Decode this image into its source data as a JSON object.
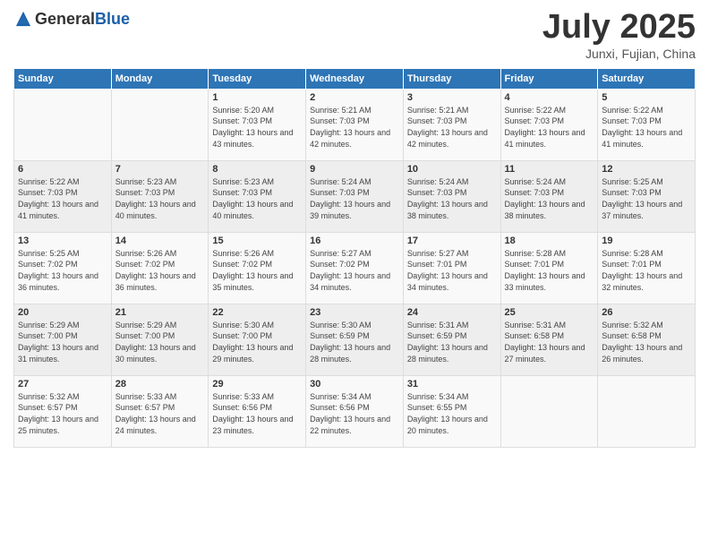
{
  "header": {
    "logo_general": "General",
    "logo_blue": "Blue",
    "month_year": "July 2025",
    "location": "Junxi, Fujian, China"
  },
  "weekdays": [
    "Sunday",
    "Monday",
    "Tuesday",
    "Wednesday",
    "Thursday",
    "Friday",
    "Saturday"
  ],
  "weeks": [
    [
      {
        "day": null,
        "sunrise": null,
        "sunset": null,
        "daylight": null
      },
      {
        "day": null,
        "sunrise": null,
        "sunset": null,
        "daylight": null
      },
      {
        "day": "1",
        "sunrise": "Sunrise: 5:20 AM",
        "sunset": "Sunset: 7:03 PM",
        "daylight": "Daylight: 13 hours and 43 minutes."
      },
      {
        "day": "2",
        "sunrise": "Sunrise: 5:21 AM",
        "sunset": "Sunset: 7:03 PM",
        "daylight": "Daylight: 13 hours and 42 minutes."
      },
      {
        "day": "3",
        "sunrise": "Sunrise: 5:21 AM",
        "sunset": "Sunset: 7:03 PM",
        "daylight": "Daylight: 13 hours and 42 minutes."
      },
      {
        "day": "4",
        "sunrise": "Sunrise: 5:22 AM",
        "sunset": "Sunset: 7:03 PM",
        "daylight": "Daylight: 13 hours and 41 minutes."
      },
      {
        "day": "5",
        "sunrise": "Sunrise: 5:22 AM",
        "sunset": "Sunset: 7:03 PM",
        "daylight": "Daylight: 13 hours and 41 minutes."
      }
    ],
    [
      {
        "day": "6",
        "sunrise": "Sunrise: 5:22 AM",
        "sunset": "Sunset: 7:03 PM",
        "daylight": "Daylight: 13 hours and 41 minutes."
      },
      {
        "day": "7",
        "sunrise": "Sunrise: 5:23 AM",
        "sunset": "Sunset: 7:03 PM",
        "daylight": "Daylight: 13 hours and 40 minutes."
      },
      {
        "day": "8",
        "sunrise": "Sunrise: 5:23 AM",
        "sunset": "Sunset: 7:03 PM",
        "daylight": "Daylight: 13 hours and 40 minutes."
      },
      {
        "day": "9",
        "sunrise": "Sunrise: 5:24 AM",
        "sunset": "Sunset: 7:03 PM",
        "daylight": "Daylight: 13 hours and 39 minutes."
      },
      {
        "day": "10",
        "sunrise": "Sunrise: 5:24 AM",
        "sunset": "Sunset: 7:03 PM",
        "daylight": "Daylight: 13 hours and 38 minutes."
      },
      {
        "day": "11",
        "sunrise": "Sunrise: 5:24 AM",
        "sunset": "Sunset: 7:03 PM",
        "daylight": "Daylight: 13 hours and 38 minutes."
      },
      {
        "day": "12",
        "sunrise": "Sunrise: 5:25 AM",
        "sunset": "Sunset: 7:03 PM",
        "daylight": "Daylight: 13 hours and 37 minutes."
      }
    ],
    [
      {
        "day": "13",
        "sunrise": "Sunrise: 5:25 AM",
        "sunset": "Sunset: 7:02 PM",
        "daylight": "Daylight: 13 hours and 36 minutes."
      },
      {
        "day": "14",
        "sunrise": "Sunrise: 5:26 AM",
        "sunset": "Sunset: 7:02 PM",
        "daylight": "Daylight: 13 hours and 36 minutes."
      },
      {
        "day": "15",
        "sunrise": "Sunrise: 5:26 AM",
        "sunset": "Sunset: 7:02 PM",
        "daylight": "Daylight: 13 hours and 35 minutes."
      },
      {
        "day": "16",
        "sunrise": "Sunrise: 5:27 AM",
        "sunset": "Sunset: 7:02 PM",
        "daylight": "Daylight: 13 hours and 34 minutes."
      },
      {
        "day": "17",
        "sunrise": "Sunrise: 5:27 AM",
        "sunset": "Sunset: 7:01 PM",
        "daylight": "Daylight: 13 hours and 34 minutes."
      },
      {
        "day": "18",
        "sunrise": "Sunrise: 5:28 AM",
        "sunset": "Sunset: 7:01 PM",
        "daylight": "Daylight: 13 hours and 33 minutes."
      },
      {
        "day": "19",
        "sunrise": "Sunrise: 5:28 AM",
        "sunset": "Sunset: 7:01 PM",
        "daylight": "Daylight: 13 hours and 32 minutes."
      }
    ],
    [
      {
        "day": "20",
        "sunrise": "Sunrise: 5:29 AM",
        "sunset": "Sunset: 7:00 PM",
        "daylight": "Daylight: 13 hours and 31 minutes."
      },
      {
        "day": "21",
        "sunrise": "Sunrise: 5:29 AM",
        "sunset": "Sunset: 7:00 PM",
        "daylight": "Daylight: 13 hours and 30 minutes."
      },
      {
        "day": "22",
        "sunrise": "Sunrise: 5:30 AM",
        "sunset": "Sunset: 7:00 PM",
        "daylight": "Daylight: 13 hours and 29 minutes."
      },
      {
        "day": "23",
        "sunrise": "Sunrise: 5:30 AM",
        "sunset": "Sunset: 6:59 PM",
        "daylight": "Daylight: 13 hours and 28 minutes."
      },
      {
        "day": "24",
        "sunrise": "Sunrise: 5:31 AM",
        "sunset": "Sunset: 6:59 PM",
        "daylight": "Daylight: 13 hours and 28 minutes."
      },
      {
        "day": "25",
        "sunrise": "Sunrise: 5:31 AM",
        "sunset": "Sunset: 6:58 PM",
        "daylight": "Daylight: 13 hours and 27 minutes."
      },
      {
        "day": "26",
        "sunrise": "Sunrise: 5:32 AM",
        "sunset": "Sunset: 6:58 PM",
        "daylight": "Daylight: 13 hours and 26 minutes."
      }
    ],
    [
      {
        "day": "27",
        "sunrise": "Sunrise: 5:32 AM",
        "sunset": "Sunset: 6:57 PM",
        "daylight": "Daylight: 13 hours and 25 minutes."
      },
      {
        "day": "28",
        "sunrise": "Sunrise: 5:33 AM",
        "sunset": "Sunset: 6:57 PM",
        "daylight": "Daylight: 13 hours and 24 minutes."
      },
      {
        "day": "29",
        "sunrise": "Sunrise: 5:33 AM",
        "sunset": "Sunset: 6:56 PM",
        "daylight": "Daylight: 13 hours and 23 minutes."
      },
      {
        "day": "30",
        "sunrise": "Sunrise: 5:34 AM",
        "sunset": "Sunset: 6:56 PM",
        "daylight": "Daylight: 13 hours and 22 minutes."
      },
      {
        "day": "31",
        "sunrise": "Sunrise: 5:34 AM",
        "sunset": "Sunset: 6:55 PM",
        "daylight": "Daylight: 13 hours and 20 minutes."
      },
      {
        "day": null,
        "sunrise": null,
        "sunset": null,
        "daylight": null
      },
      {
        "day": null,
        "sunrise": null,
        "sunset": null,
        "daylight": null
      }
    ]
  ]
}
